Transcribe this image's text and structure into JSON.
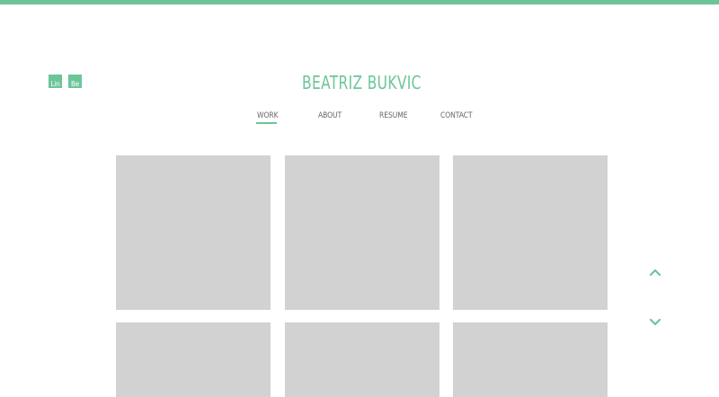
{
  "header": {
    "title": "BEATRIZ BUKVIC",
    "accent_color": "#6cc599"
  },
  "social": [
    {
      "label": "Lin",
      "icon": "linkedin-icon"
    },
    {
      "label": "Be",
      "icon": "behance-icon"
    }
  ],
  "nav": {
    "items": [
      "WORK",
      "ABOUT",
      "RESUME",
      "CONTACT"
    ],
    "active": "WORK"
  },
  "gallery": {
    "tile_color": "#d2d2d2",
    "tiles": 6
  },
  "scroll": {
    "up_icon": "chevron-up-icon",
    "down_icon": "chevron-down-icon"
  }
}
